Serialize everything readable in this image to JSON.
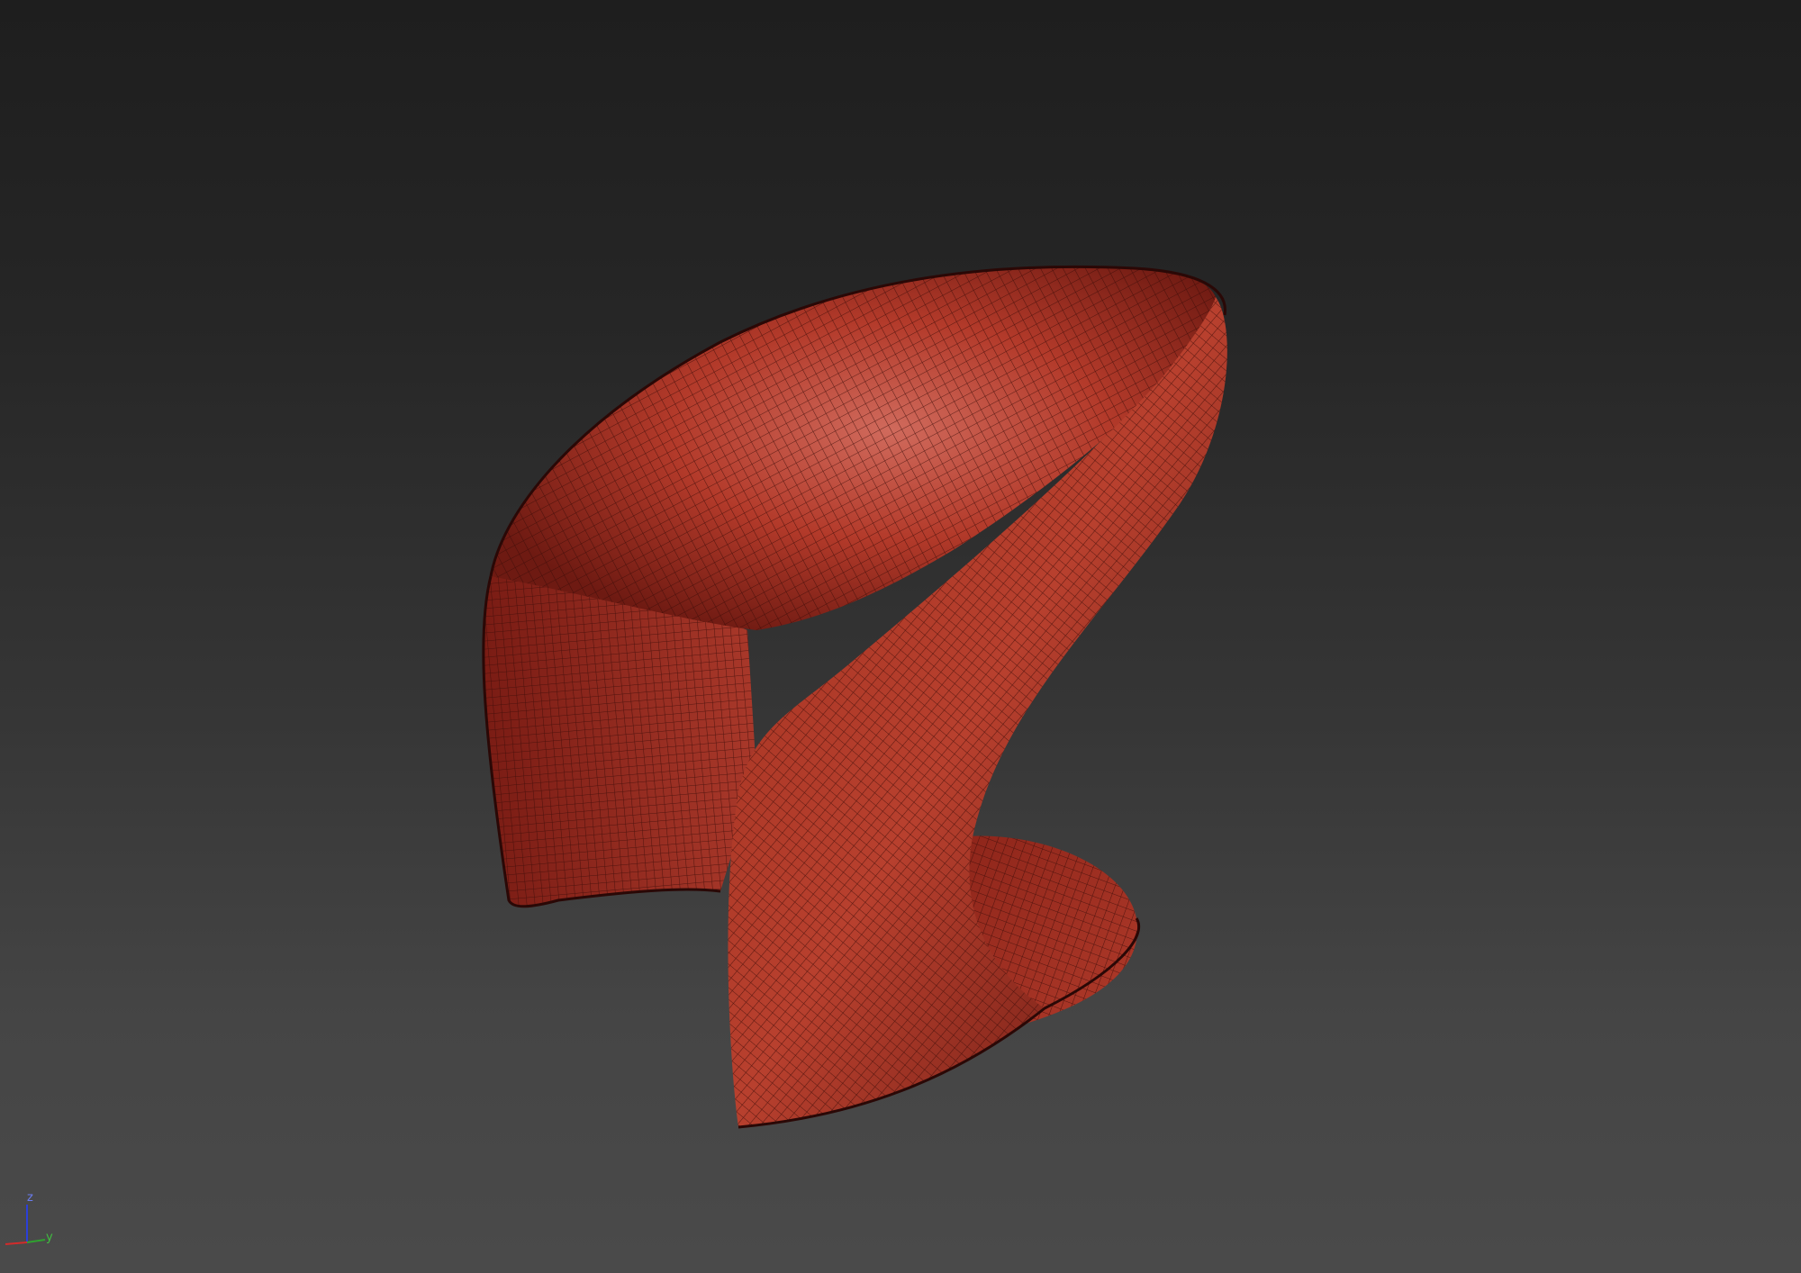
{
  "viewport": {
    "background_top": "#1e1e1e",
    "background_bottom": "#4a4a4a",
    "display_mode": "wireframe-on-shaded"
  },
  "model": {
    "object": "chair",
    "material_color": "#b33a2a",
    "shadow_color": "#5a1410",
    "highlight_color": "#d46a5a",
    "wire_color": "#3a0c08"
  },
  "axis_gizmo": {
    "z_label": "z",
    "y_label": "y",
    "x_color": "#d22b2b",
    "y_color": "#2fa12f",
    "z_color": "#2b3fd8"
  }
}
